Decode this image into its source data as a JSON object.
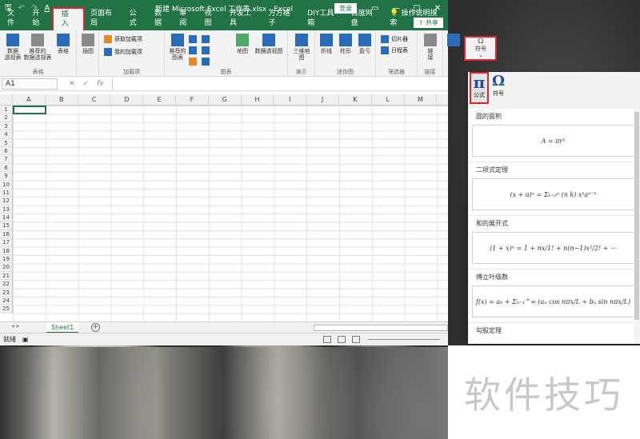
{
  "window": {
    "title": "新建 Microsoft Excel 工作表.xlsx  -  Excel",
    "login_label": "登录",
    "share_label": "共享",
    "controls": {
      "restore": "▭",
      "minimize": "—",
      "maximize": "□",
      "close": "✕"
    }
  },
  "qat": {
    "save": "🖫",
    "undo": "↶",
    "redo": "↷",
    "font_color": "A",
    "more": "⌄"
  },
  "menu": {
    "tabs": [
      "文件",
      "开始",
      "插入",
      "页面布局",
      "公式",
      "数据",
      "审阅",
      "视图",
      "开发工具",
      "方方格子",
      "DIY工具箱",
      "百度网盘"
    ],
    "active": "插入",
    "search_label": "操作说明搜索"
  },
  "ribbon": {
    "groups": {
      "tables": {
        "label": "表格",
        "pivot": "数据\n透视表",
        "recommended_pivot": "推荐的\n数据透视表",
        "table": "表格"
      },
      "illustrations": {
        "label": "插图"
      },
      "addins": {
        "label": "加载项",
        "get": "获取加载项",
        "my": "我的加载项"
      },
      "charts": {
        "label": "图表",
        "recommended": "推荐的\n图表",
        "map": "地图",
        "pivot_chart": "数据透视图"
      },
      "tours": {
        "label": "演示",
        "map3d": "三维地\n图"
      },
      "sparklines": {
        "label": "迷你图",
        "line": "折线",
        "column": "柱形",
        "winloss": "盈亏"
      },
      "filters": {
        "label": "筛选器",
        "slicer": "切片器",
        "timeline": "日程表"
      },
      "links": {
        "label": "链接",
        "link": "链\n接"
      },
      "text": {
        "label": "",
        "text": "文本"
      },
      "symbols": {
        "label": "",
        "symbol": "符号"
      }
    }
  },
  "formula_bar": {
    "name_box": "A1",
    "cancel": "✕",
    "enter": "✓",
    "fx": "fx"
  },
  "sheet": {
    "columns": [
      "A",
      "B",
      "C",
      "D",
      "E",
      "F",
      "G",
      "H",
      "I",
      "J",
      "K",
      "L",
      "M",
      "N"
    ],
    "rows": [
      "1",
      "2",
      "3",
      "4",
      "5",
      "6",
      "7",
      "8",
      "9",
      "10",
      "11",
      "12",
      "13",
      "14",
      "15",
      "16",
      "17",
      "18",
      "19",
      "20",
      "21",
      "22",
      "23",
      "24",
      "25"
    ],
    "tab_name": "Sheet1",
    "add": "+"
  },
  "status": {
    "ready": "就绪"
  },
  "symbol_pane": {
    "equation": {
      "glyph": "π",
      "label": "公式",
      "more": "⌄"
    },
    "symbol": {
      "glyph": "Ω",
      "label": "符号"
    },
    "items": [
      {
        "title": "圆的面积",
        "formula": "A = πr²"
      },
      {
        "title": "二项式定理",
        "formula": "(x + a)ⁿ = Σₖ₌₀ⁿ (n k) xᵏaⁿ⁻ᵏ"
      },
      {
        "title": "和的展开式",
        "formula": "(1 + x)ⁿ = 1 + nx/1! + n(n−1)x²/2! + ⋯"
      },
      {
        "title": "傅立叶级数",
        "formula": "f(x) = a₀ + Σₙ₌₁^∞ (aₙ cos nπx/L + bₙ sin nπx/L)"
      },
      {
        "title": "勾股定理",
        "formula": ""
      }
    ]
  },
  "watermark": "软件技巧"
}
